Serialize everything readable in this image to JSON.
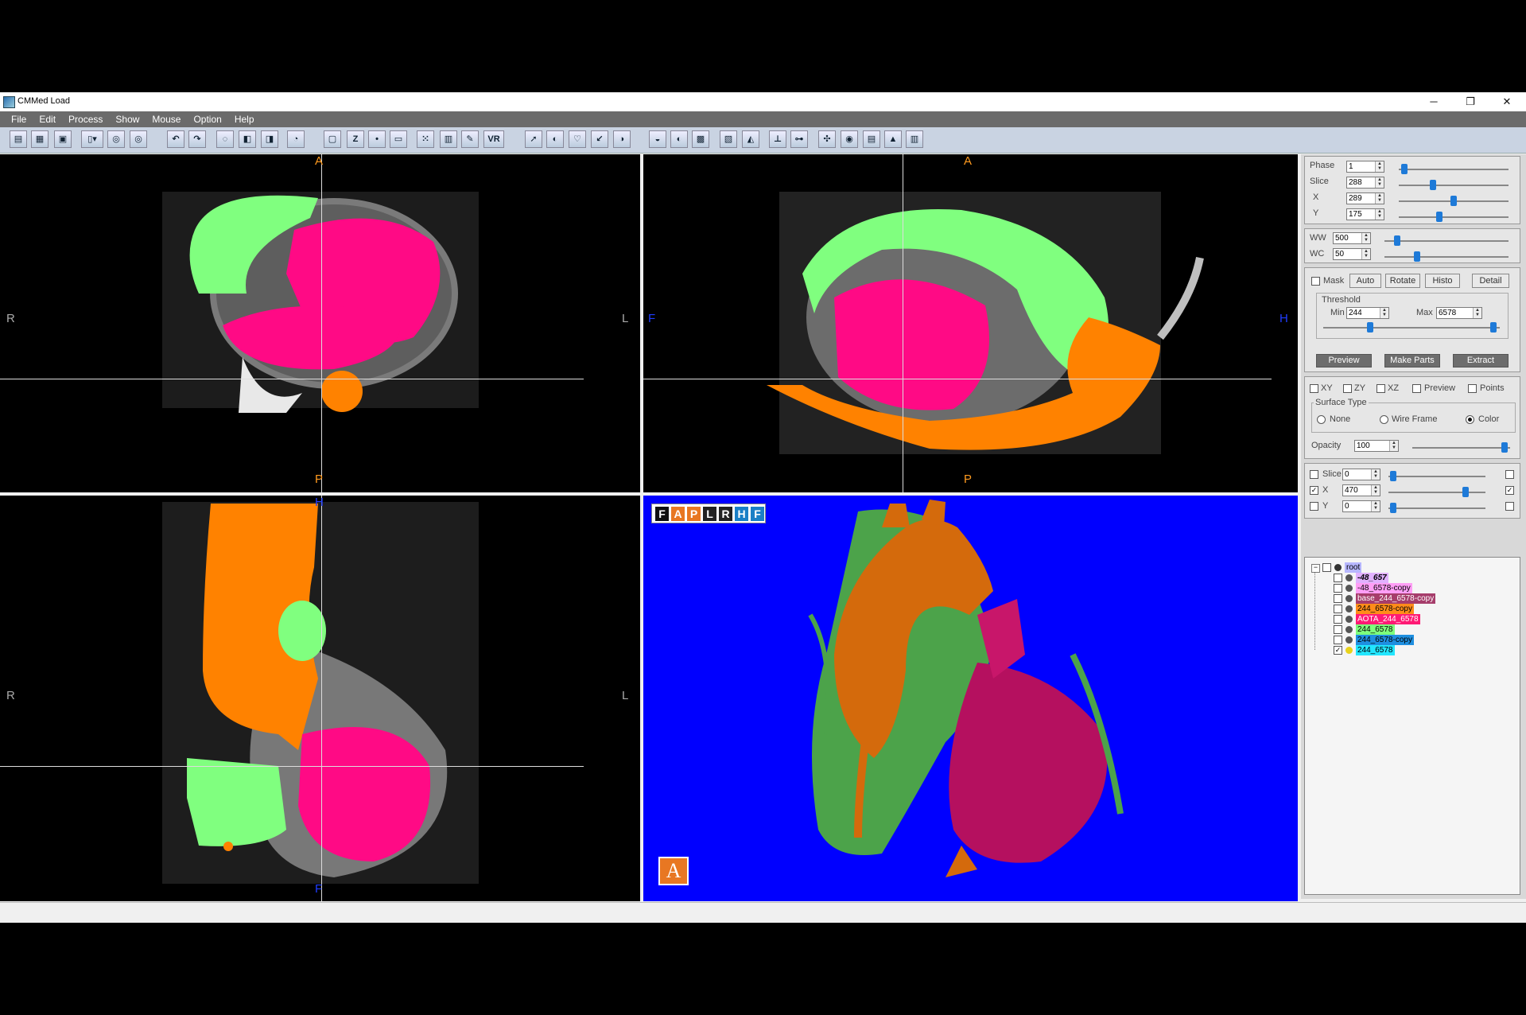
{
  "window": {
    "title": "CMMed  Load",
    "min": "─",
    "restore": "❐",
    "close": "✕"
  },
  "menu": [
    "File",
    "Edit",
    "Process",
    "Show",
    "Mouse",
    "Option",
    "Help"
  ],
  "toolbar": {
    "vr_label": "VR",
    "z_label": "Z"
  },
  "views": {
    "axial": {
      "top": "A",
      "bottom": "P",
      "left": "R",
      "right": "L"
    },
    "sagittal": {
      "top": "A",
      "bottom": "P",
      "left": "F",
      "right": "H"
    },
    "coronal": {
      "top": "H",
      "bottom": "F",
      "left": "R",
      "right": "L"
    },
    "render3d": {
      "buttons": [
        "F",
        "A",
        "P",
        "L",
        "R",
        "H",
        "F"
      ],
      "corner": "A"
    }
  },
  "panel": {
    "phase": {
      "label": "Phase",
      "value": "1",
      "level": 0.02
    },
    "slice": {
      "label": "Slice",
      "value": "288",
      "level": 0.3
    },
    "x": {
      "label": "X",
      "value": "289",
      "level": 0.5
    },
    "y": {
      "label": "Y",
      "value": "175",
      "level": 0.36
    },
    "ww": {
      "label": "WW",
      "value": "500",
      "level": 0.08
    },
    "wc": {
      "label": "WC",
      "value": "50",
      "level": 0.25
    },
    "mask": {
      "label": "Mask",
      "checked": false
    },
    "buttons": {
      "auto": "Auto",
      "rotate": "Rotate",
      "histo": "Histo",
      "detail": "Detail"
    },
    "threshold": {
      "title": "Threshold",
      "min_label": "Min",
      "min_value": "244",
      "max_label": "Max",
      "max_value": "6578"
    },
    "actions": {
      "preview": "Preview",
      "make_parts": "Make Parts",
      "extract": "Extract"
    },
    "view_checks": {
      "xy": "XY",
      "zy": "ZY",
      "xz": "XZ",
      "preview": "Preview",
      "points": "Points"
    },
    "surface": {
      "title": "Surface Type",
      "none": "None",
      "wire": "Wire Frame",
      "color": "Color",
      "selected": "Color"
    },
    "opacity": {
      "label": "Opacity",
      "value": "100",
      "level": 0.97
    },
    "planes": {
      "slice": {
        "label": "Slice",
        "value": "0",
        "checked": false,
        "level": 0.02
      },
      "x": {
        "label": "X",
        "value": "470",
        "checked": true,
        "level": 0.82
      },
      "y": {
        "label": "Y",
        "value": "0",
        "checked": false,
        "level": 0.02
      }
    }
  },
  "tree": {
    "root": "root",
    "items": [
      {
        "label": "-48_657",
        "bg": "#e1b1ff",
        "fg": "#000",
        "checked": false
      },
      {
        "label": "-48_6578-copy",
        "bg": "#ff9ef5",
        "fg": "#000",
        "checked": false
      },
      {
        "label": "base_244_6578-copy",
        "bg": "#a63d6b",
        "fg": "#fff",
        "checked": false
      },
      {
        "label": "244_6578-copy",
        "bg": "#ff8c1a",
        "fg": "#000",
        "checked": false
      },
      {
        "label": "AOTA_244_6578",
        "bg": "#ff1a75",
        "fg": "#fff",
        "checked": false
      },
      {
        "label": "244_6578",
        "bg": "#7dff7d",
        "fg": "#000",
        "checked": false
      },
      {
        "label": "244_6578-copy",
        "bg": "#1f8fe0",
        "fg": "#000",
        "checked": false
      },
      {
        "label": "244_6578",
        "bg": "#22e6ff",
        "fg": "#000",
        "checked": true
      }
    ]
  },
  "colors": {
    "pink": "#ff0a85",
    "green": "#80ff7f",
    "orange": "#ff8200",
    "render_bg": "#0000ff",
    "orient_orange": "#ff9a1f",
    "orient_blue": "#1f3dff",
    "orient_gray": "#aaaaaa"
  }
}
